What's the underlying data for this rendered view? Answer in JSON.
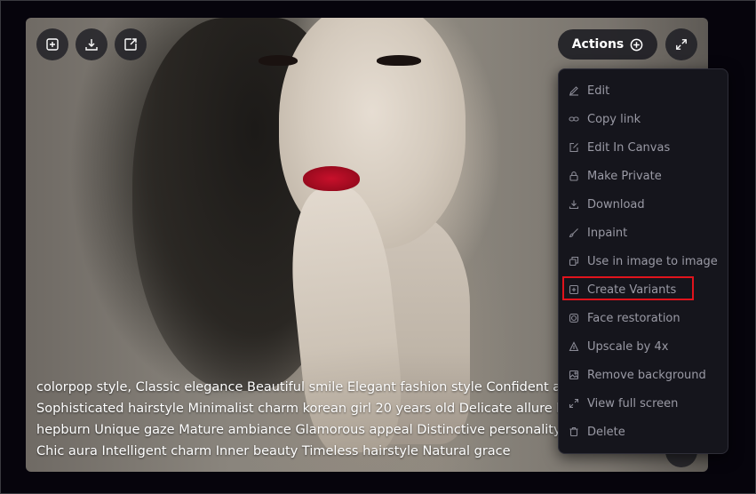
{
  "toolbar": {
    "left_icons": [
      "add-square-icon",
      "download-icon",
      "share-out-icon"
    ],
    "actions_label": "Actions",
    "actions_icon": "plus-circle-icon",
    "expand_icon": "expand-icon"
  },
  "caption": {
    "lines": [
      "colorpop style, Classic elegance Beautiful smile Elegant fashion style Confident and gr",
      "Sophisticated hairstyle Minimalist charm korean girl 20 years old Delicate allure looks",
      "hepburn Unique gaze Mature ambiance Glamorous appeal Distinctive personality Inn",
      "Chic aura Intelligent charm Inner beauty Timeless hairstyle Natural grace"
    ]
  },
  "menu": {
    "items": [
      {
        "label": "Edit",
        "icon": "pencil-icon"
      },
      {
        "label": "Copy link",
        "icon": "link-icon"
      },
      {
        "label": "Edit In Canvas",
        "icon": "edit-box-icon"
      },
      {
        "label": "Make Private",
        "icon": "lock-icon"
      },
      {
        "label": "Download",
        "icon": "download-icon"
      },
      {
        "label": "Inpaint",
        "icon": "brush-icon"
      },
      {
        "label": "Use in image to image",
        "icon": "copy-icon"
      },
      {
        "label": "Create Variants",
        "icon": "plus-square-icon"
      },
      {
        "label": "Face restoration",
        "icon": "face-icon"
      },
      {
        "label": "Upscale by 4x",
        "icon": "upscale-icon"
      },
      {
        "label": "Remove background",
        "icon": "image-icon"
      },
      {
        "label": "View full screen",
        "icon": "expand-icon"
      },
      {
        "label": "Delete",
        "icon": "trash-icon"
      }
    ],
    "highlighted_item": "Create Variants"
  },
  "colors": {
    "background": "#08050f",
    "menu_bg": "#15151c",
    "menu_text": "#9a9aa5",
    "highlight": "#e0131c"
  }
}
